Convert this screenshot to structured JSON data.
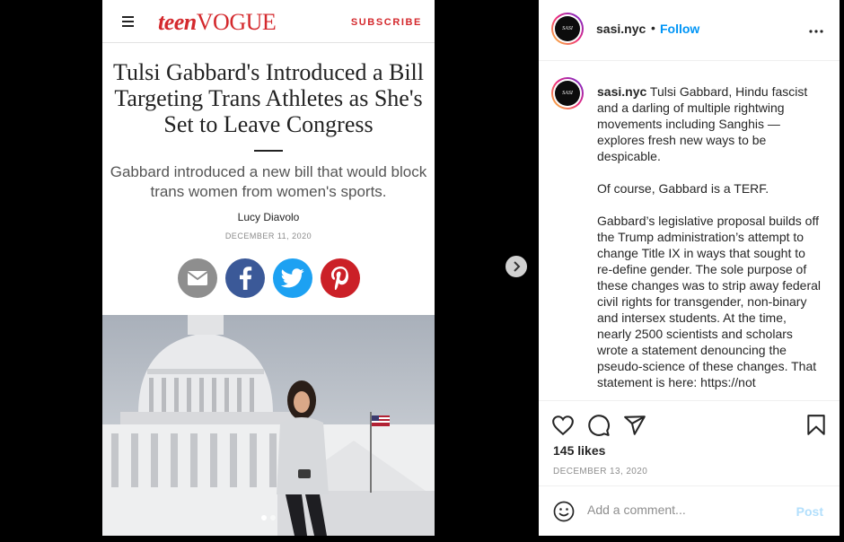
{
  "article": {
    "menu_icon": "hamburger-icon",
    "logo_teen": "teen",
    "logo_vogue": "VOGUE",
    "subscribe": "SUBSCRIBE",
    "headline": "Tulsi Gabbard's Introduced a Bill Targeting Trans Athletes as She's Set to Leave Congress",
    "dek": "Gabbard introduced a new bill that would block trans women from women's sports.",
    "author": "Lucy Diavolo",
    "date": "DECEMBER 11, 2020",
    "share": [
      {
        "icon": "email-icon",
        "color": "#8e8e8e"
      },
      {
        "icon": "facebook-icon",
        "color": "#3b5998"
      },
      {
        "icon": "twitter-icon",
        "color": "#1da1f2"
      },
      {
        "icon": "pinterest-icon",
        "color": "#cb2027"
      }
    ],
    "brand_color": "#d4292d"
  },
  "carousel": {
    "slide_count": 2,
    "active_index": 0,
    "next_icon": "chevron-right-icon"
  },
  "post": {
    "username": "sasi.nyc",
    "avatar_text": "SASI",
    "separator": "•",
    "follow_label": "Follow",
    "more_icon": "more-options-icon",
    "caption_paragraphs": [
      "Tulsi Gabbard, Hindu fascist and a darling of multiple rightwing movements including Sanghis — explores fresh new ways to be despicable.",
      "Of course, Gabbard is a TERF.",
      "Gabbard’s legislative proposal builds off the Trump administration’s attempt to change Title IX in ways that sought to re-define gender. The sole purpose of these changes was to strip away federal civil rights for transgender, non-binary and intersex students. At the time, nearly 2500 scientists and scholars wrote a statement denouncing the pseudo-science of these changes. That statement is here: https://not"
    ],
    "likes": "145 likes",
    "date": "DECEMBER 13, 2020",
    "action_icons": [
      "heart-icon",
      "comment-icon",
      "share-icon",
      "bookmark-icon"
    ],
    "comment_placeholder": "Add a comment...",
    "post_label": "Post",
    "follow_color": "#0095f6"
  }
}
